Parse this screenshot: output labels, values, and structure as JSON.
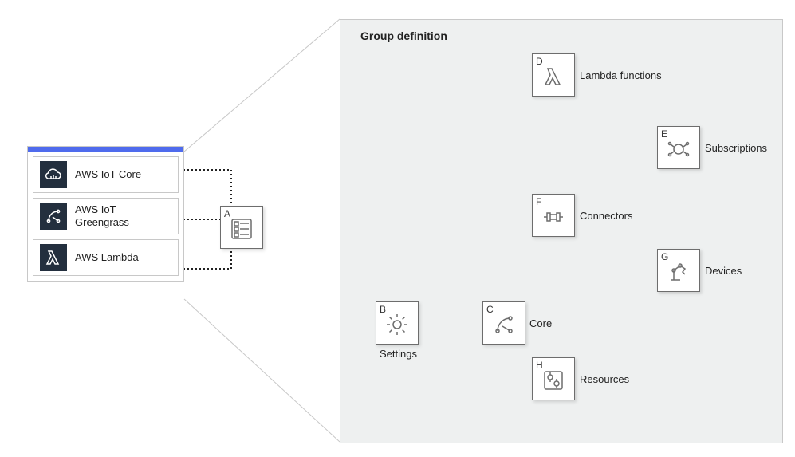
{
  "services": {
    "iot_core": "AWS IoT Core",
    "greengrass_l1": "AWS IoT",
    "greengrass_l2": "Greengrass",
    "lambda": "AWS Lambda"
  },
  "panel_title": "Group definition",
  "nodes": {
    "A": {
      "letter": "A",
      "label": ""
    },
    "B": {
      "letter": "B",
      "label": "Settings"
    },
    "C": {
      "letter": "C",
      "label": "Core"
    },
    "D": {
      "letter": "D",
      "label": "Lambda functions"
    },
    "E": {
      "letter": "E",
      "label": "Subscriptions"
    },
    "F": {
      "letter": "F",
      "label": "Connectors"
    },
    "G": {
      "letter": "G",
      "label": "Devices"
    },
    "H": {
      "letter": "H",
      "label": "Resources"
    }
  }
}
